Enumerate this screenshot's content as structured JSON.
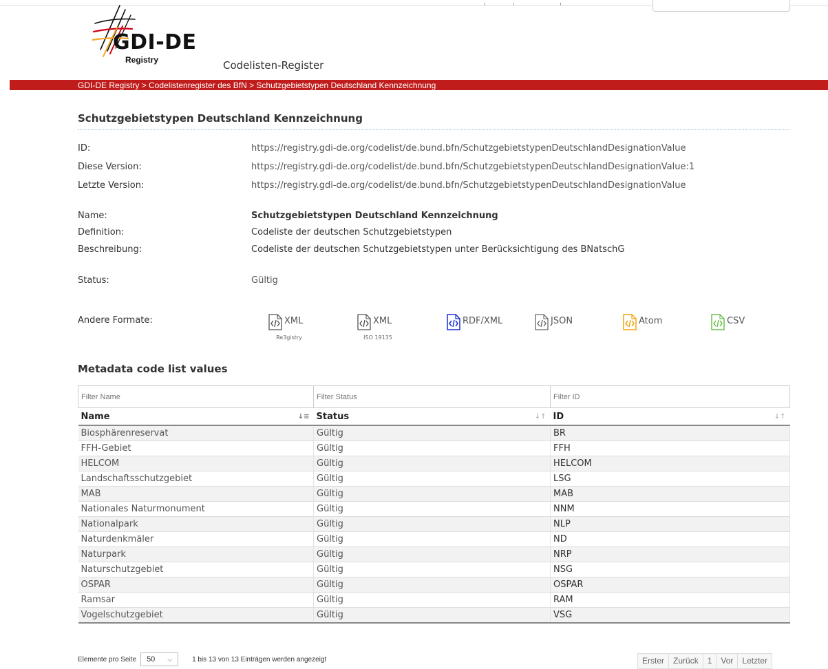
{
  "header": {
    "logo_text": "GDI-DE",
    "logo_subtext": "Registry",
    "app_title": "Codelisten-Register"
  },
  "breadcrumb": "GDI-DE Registry > Codelistenregister des BfN > Schutzgebietstypen Deutschland Kennzeichnung",
  "page_title": "Schutzgebietstypen Deutschland Kennzeichnung",
  "properties": {
    "id_label": "ID:",
    "id_value": "https://registry.gdi-de.org/codelist/de.bund.bfn/SchutzgebietstypenDeutschlandDesignationValue",
    "version_label": "Diese Version:",
    "version_value": "https://registry.gdi-de.org/codelist/de.bund.bfn/SchutzgebietstypenDeutschlandDesignationValue:1",
    "latest_label": "Letzte Version:",
    "latest_value": "https://registry.gdi-de.org/codelist/de.bund.bfn/SchutzgebietstypenDeutschlandDesignationValue",
    "name_label": "Name:",
    "name_value": "Schutzgebietstypen Deutschland Kennzeichnung",
    "definition_label": "Definition:",
    "definition_value": "Codeliste der deutschen Schutzgebietstypen",
    "description_label": "Beschreibung:",
    "description_value": "Codeliste der deutschen Schutzgebietstypen unter Berücksichtigung des BNatschG",
    "status_label": "Status:",
    "status_value": "Gültig",
    "formats_label": "Andere Formate:"
  },
  "formats": [
    {
      "label": "XML",
      "sub": "Re3gistry",
      "color": "#555555"
    },
    {
      "label": "XML",
      "sub": "ISO 19135",
      "color": "#555555"
    },
    {
      "label": "RDF/XML",
      "sub": "",
      "color": "#1a2fd6"
    },
    {
      "label": "JSON",
      "sub": "",
      "color": "#666666"
    },
    {
      "label": "Atom",
      "sub": "",
      "color": "#f0a30a"
    },
    {
      "label": "CSV",
      "sub": "",
      "color": "#6cc04a"
    }
  ],
  "values_section_title": "Metadata code list values",
  "table": {
    "filters": [
      "Filter Name",
      "Filter Status",
      "Filter ID"
    ],
    "headers": [
      "Name",
      "Status",
      "ID"
    ],
    "rows": [
      [
        "Biosphärenreservat",
        "Gültig",
        "BR"
      ],
      [
        "FFH-Gebiet",
        "Gültig",
        "FFH"
      ],
      [
        "HELCOM",
        "Gültig",
        "HELCOM"
      ],
      [
        "Landschaftsschutzgebiet",
        "Gültig",
        "LSG"
      ],
      [
        "MAB",
        "Gültig",
        "MAB"
      ],
      [
        "Nationales Naturmonument",
        "Gültig",
        "NNM"
      ],
      [
        "Nationalpark",
        "Gültig",
        "NLP"
      ],
      [
        "Naturdenkmäler",
        "Gültig",
        "ND"
      ],
      [
        "Naturpark",
        "Gültig",
        "NRP"
      ],
      [
        "Naturschutzgebiet",
        "Gültig",
        "NSG"
      ],
      [
        "OSPAR",
        "Gültig",
        "OSPAR"
      ],
      [
        "Ramsar",
        "Gültig",
        "RAM"
      ],
      [
        "Vogelschutzgebiet",
        "Gültig",
        "VSG"
      ]
    ]
  },
  "paging": {
    "per_page_label": "Elemente pro Seite",
    "per_page_value": "50",
    "info": "1 bis 13 von 13 Einträgen werden angezeigt",
    "buttons": [
      "Erster",
      "Zurück",
      "1",
      "Vor",
      "Letzter"
    ]
  },
  "colors": {
    "brand_red": "#c01c1c",
    "logo_red": "#d0021b",
    "logo_orange": "#f5a623"
  }
}
